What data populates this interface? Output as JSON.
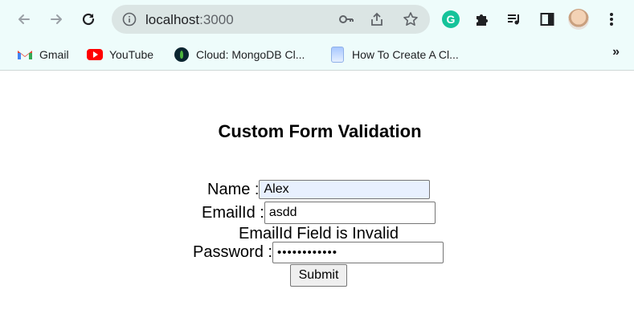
{
  "browser": {
    "url_host": "localhost",
    "url_port": ":3000",
    "icons": {
      "back": "arrow-left-icon",
      "forward": "arrow-right-icon",
      "reload": "reload-icon",
      "info": "info-icon",
      "password": "key-icon",
      "share": "share-icon",
      "bookmark": "star-icon",
      "grammarly": "grammarly-icon",
      "extensions": "puzzle-icon",
      "media": "media-queue-icon",
      "sidepanel": "side-panel-icon",
      "menu": "kebab-menu-icon"
    },
    "grammarly_letter": "G",
    "bookmarks": [
      {
        "label": "Gmail",
        "icon": "gmail-icon"
      },
      {
        "label": "YouTube",
        "icon": "youtube-icon"
      },
      {
        "label": "Cloud: MongoDB Cl...",
        "icon": "mongodb-icon"
      },
      {
        "label": "How To Create A Cl...",
        "icon": "blog-icon"
      }
    ],
    "bookmarks_more": "»"
  },
  "form": {
    "title": "Custom Form Validation",
    "name_label": "Name :",
    "name_value": "Alex",
    "email_label": "EmailId :",
    "email_value": "asdd",
    "email_error": "EmailId Field is Invalid",
    "password_label": "Password :",
    "password_value": "••••••••••••",
    "submit_label": "Submit"
  },
  "colors": {
    "chrome_bg": "#eefcfb",
    "omnibox_bg": "#dbe5e4",
    "autofill_bg": "#e8f0fe",
    "grammarly": "#15c39a"
  }
}
